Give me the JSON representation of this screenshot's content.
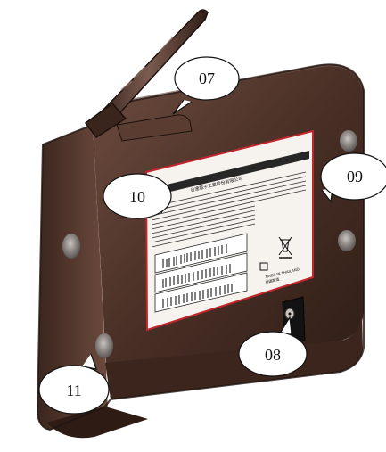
{
  "callouts": {
    "c07": "07",
    "c08": "08",
    "c09": "09",
    "c10": "10",
    "c11": "11"
  },
  "label": {
    "company_name": "台達電子工業股份有限公司",
    "model_made_in": "MADE IN THAILAND",
    "chinese_origin": "泰國製造"
  },
  "colors": {
    "device_body": "#4a3026",
    "device_shadow": "#2f1d16",
    "label_border": "#c2262d",
    "label_fill": "#f6f2ee"
  }
}
